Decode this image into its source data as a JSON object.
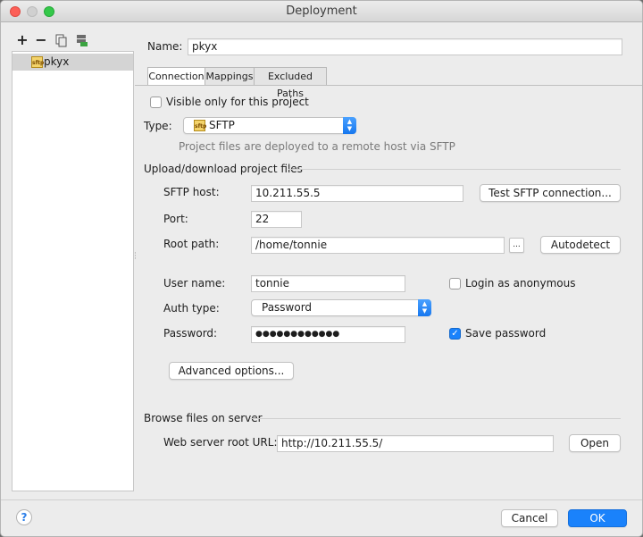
{
  "window": {
    "title": "Deployment"
  },
  "toolbar": {
    "add": "+",
    "remove": "−"
  },
  "sidebar": {
    "items": [
      {
        "label": "pkyx",
        "icon": "sftp-server-icon"
      }
    ]
  },
  "name": {
    "label": "Name:",
    "value": "pkyx"
  },
  "tabs": [
    {
      "label": "Connection",
      "active": true
    },
    {
      "label": "Mappings",
      "active": false
    },
    {
      "label": "Excluded Paths",
      "active": false
    }
  ],
  "connection": {
    "visible_only": {
      "label": "Visible only for this project",
      "checked": false
    },
    "type": {
      "label": "Type:",
      "value": "SFTP",
      "description": "Project files are deployed to a remote host via SFTP"
    },
    "upload_section": "Upload/download project files",
    "sftp_host": {
      "label": "SFTP host:",
      "value": "10.211.55.5",
      "test_button": "Test SFTP connection..."
    },
    "port": {
      "label": "Port:",
      "value": "22"
    },
    "root_path": {
      "label": "Root path:",
      "value": "/home/tonnie",
      "browse": "...",
      "autodetect_button": "Autodetect"
    },
    "user_name": {
      "label": "User name:",
      "value": "tonnie"
    },
    "login_anonymous": {
      "label": "Login as anonymous",
      "checked": false
    },
    "auth_type": {
      "label": "Auth type:",
      "value": "Password"
    },
    "password": {
      "label": "Password:",
      "value": "●●●●●●●●●●●●"
    },
    "save_password": {
      "label": "Save password",
      "checked": true
    },
    "advanced_button": "Advanced options...",
    "browse_section": "Browse files on server",
    "web_root": {
      "label": "Web server root URL:",
      "value": "http://10.211.55.5/",
      "open_button": "Open"
    }
  },
  "footer": {
    "help": "?",
    "cancel": "Cancel",
    "ok": "OK"
  },
  "colors": {
    "accent": "#1a82fb",
    "selection": "#d4d4d4"
  }
}
